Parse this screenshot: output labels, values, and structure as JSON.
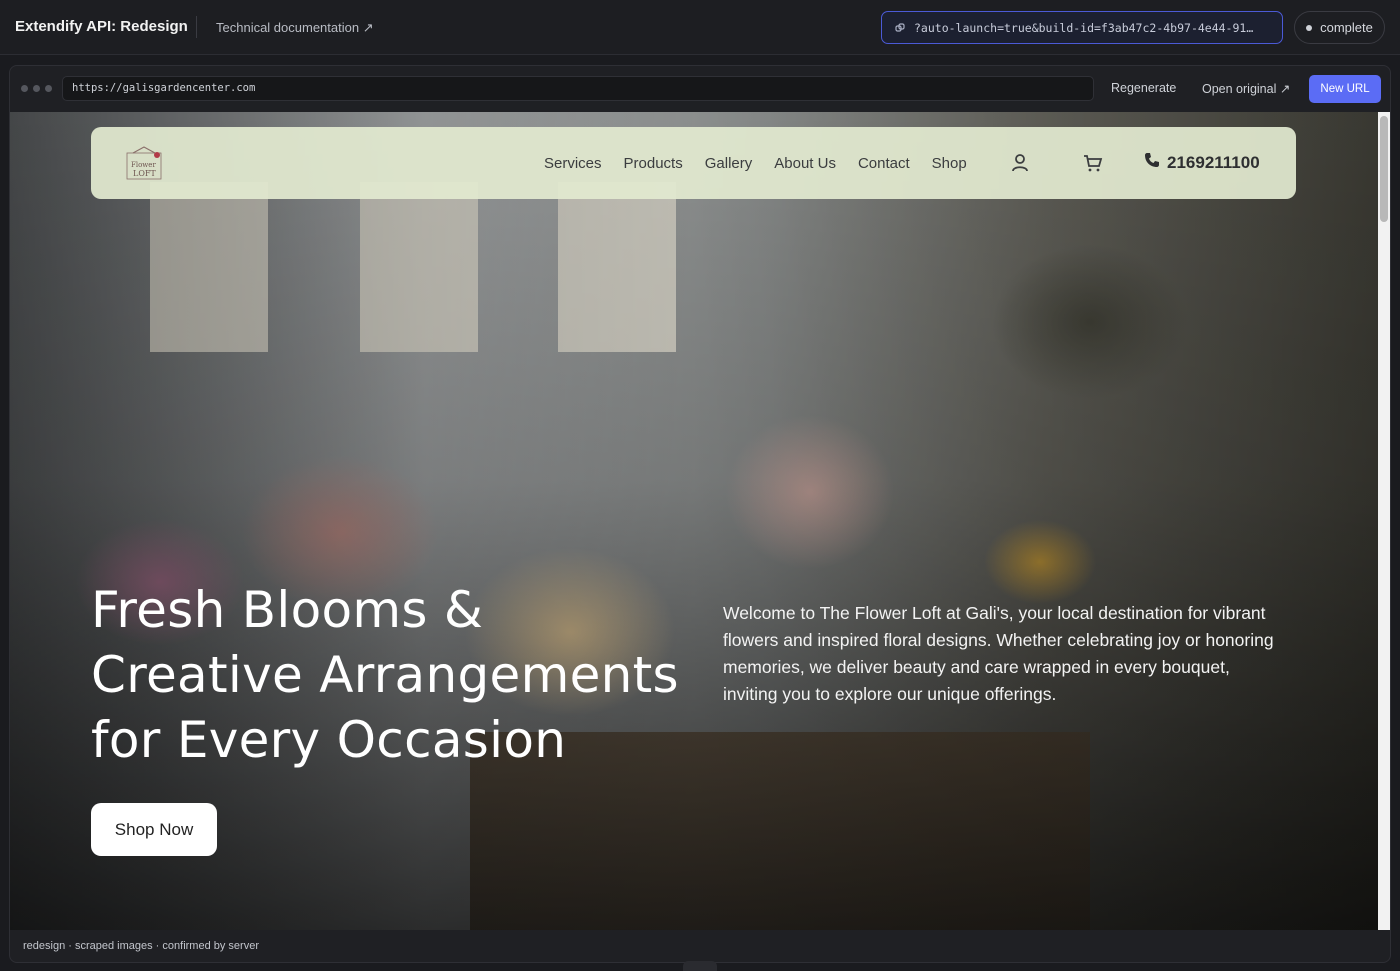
{
  "app": {
    "title": "Extendify API: Redesign",
    "doc_link": "Technical documentation ↗",
    "url_param": "?auto-launch=true&build-id=f3ab47c2-4b97-4e44-91…",
    "status": "complete"
  },
  "frame": {
    "address": "https://galisgardencenter.com",
    "regenerate": "Regenerate",
    "open_original": "Open original ↗",
    "new_url": "New URL",
    "footer_note": "redesign · scraped images · confirmed by server"
  },
  "site": {
    "logo_text": "Flower LOFT",
    "nav": [
      "Services",
      "Products",
      "Gallery",
      "About Us",
      "Contact",
      "Shop"
    ],
    "phone": "2169211100",
    "hero_title_lines": [
      "Fresh Blooms &",
      "Creative Arrangements",
      "for Every Occasion"
    ],
    "hero_text": "Welcome to The Flower Loft at Gali's, your local destination for vibrant flowers and inspired floral designs. Whether celebrating joy or honoring memories, we deliver beauty and care wrapped in every bouquet, inviting you to explore our unique offerings.",
    "cta": "Shop Now"
  },
  "icons": {
    "link": "link-icon",
    "user": "user-icon",
    "cart": "cart-icon",
    "phone": "phone-icon"
  },
  "colors": {
    "accent": "#5b6cf5",
    "nav_bg": "#e2ead0",
    "status_border": "#4b5ad6"
  }
}
